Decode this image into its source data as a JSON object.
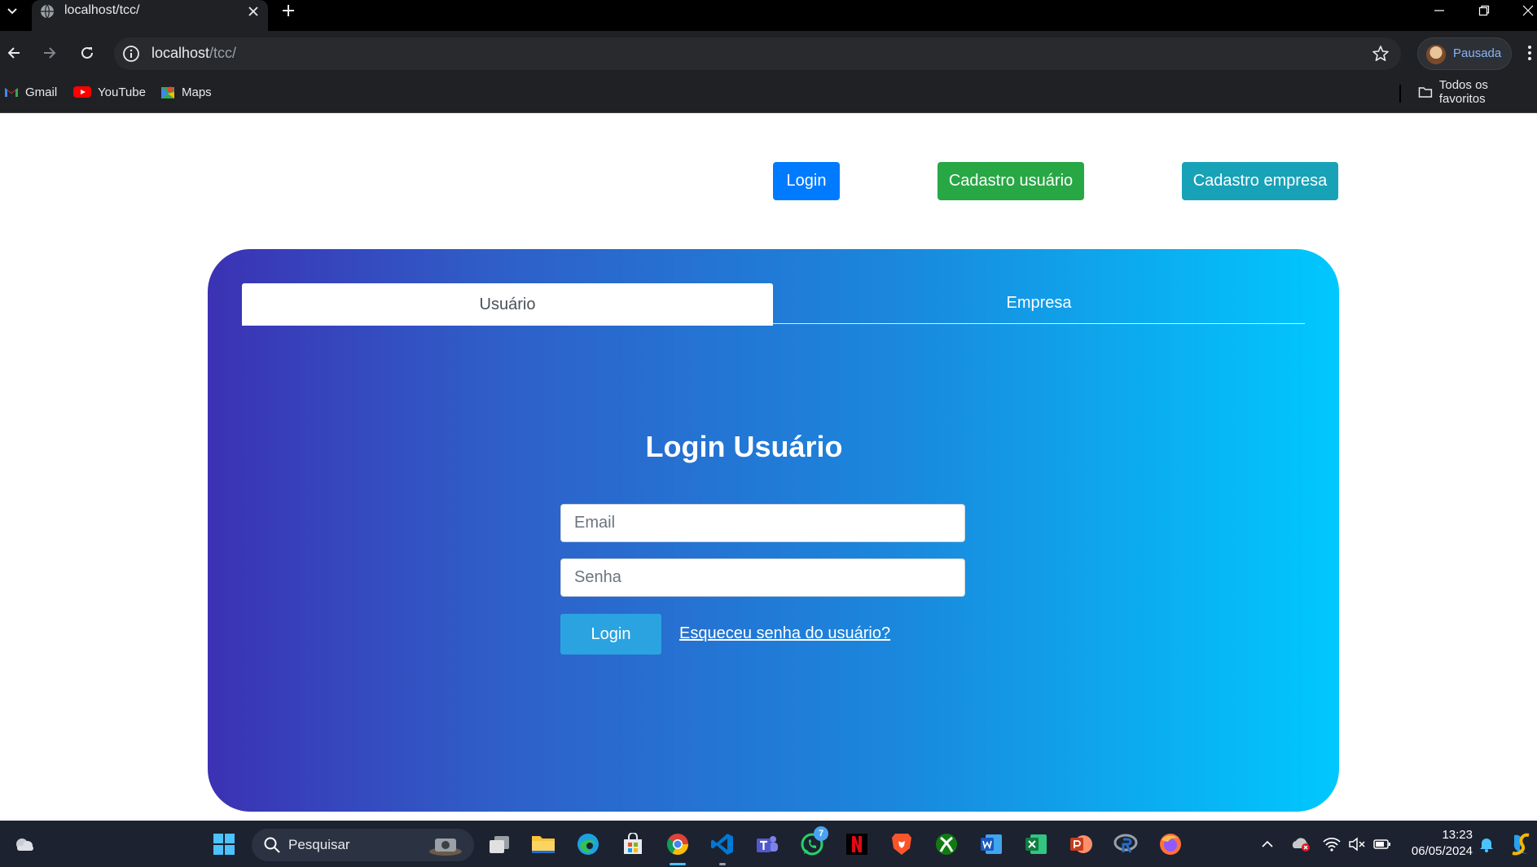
{
  "browser": {
    "tab_title": "localhost/tcc/",
    "url_host": "localhost",
    "url_path": "/tcc/",
    "profile_label": "Pausada",
    "bookmarks": [
      "Gmail",
      "YouTube",
      "Maps"
    ],
    "all_bookmarks_label": "Todos os favoritos"
  },
  "header": {
    "login": "Login",
    "cadastro_usuario": "Cadastro usuário",
    "cadastro_empresa": "Cadastro empresa"
  },
  "card": {
    "tabs": [
      {
        "label": "Usuário",
        "active": true
      },
      {
        "label": "Empresa",
        "active": false
      }
    ],
    "title": "Login Usuário",
    "email_placeholder": "Email",
    "senha_placeholder": "Senha",
    "submit_label": "Login",
    "forgot_link": "Esqueceu senha do usuário?"
  },
  "taskbar": {
    "search_placeholder": "Pesquisar",
    "whatsapp_badge": "7",
    "time": "13:23",
    "date": "06/05/2024"
  },
  "colors": {
    "login_btn": "#007bff",
    "cadastro_usuario_btn": "#28a745",
    "cadastro_empresa_btn": "#17a2b8",
    "gradient_start": "#3b32b4",
    "gradient_end": "#00c8ff"
  }
}
